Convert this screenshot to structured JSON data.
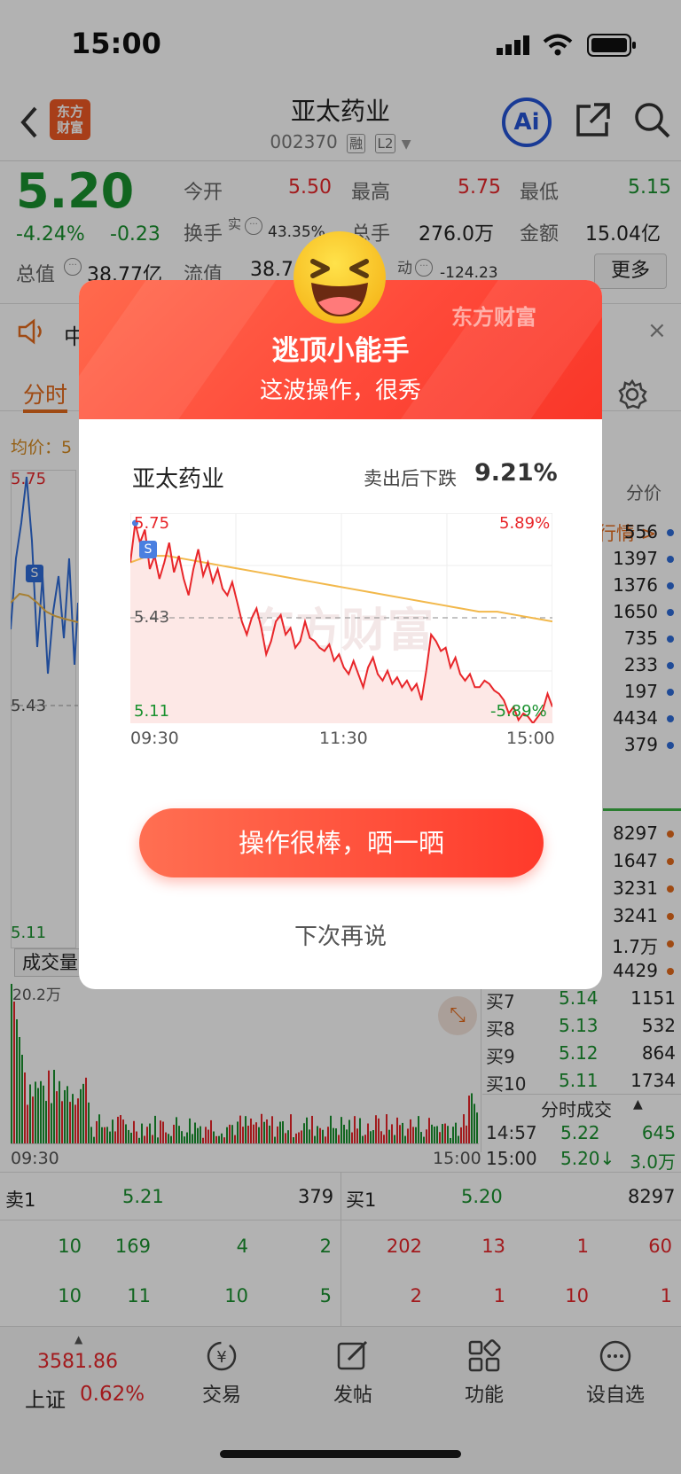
{
  "status": {
    "time": "15:00"
  },
  "header": {
    "logo": "东方\n财富",
    "logo_line1": "东方",
    "logo_line2": "财富",
    "title": "亚太药业",
    "code": "002370",
    "tag1": "融",
    "tag2": "L2",
    "ai": "Ai"
  },
  "quote": {
    "price": "5.20",
    "pct": "-4.24%",
    "chg": "-0.23",
    "open_label": "今开",
    "open": "5.50",
    "high_label": "最高",
    "high": "5.75",
    "low_label": "最低",
    "low": "5.15",
    "turnover_label": "换手",
    "turnover_sup": "实",
    "turnover": "43.35%",
    "vol_label": "总手",
    "vol": "276.0万",
    "amt_label": "金额",
    "amt": "15.04亿",
    "mcap_label": "总值",
    "mcap": "38.77亿",
    "float_label": "流值",
    "float": "38.7",
    "dyn_label": "动",
    "dyn": "-124.23",
    "more": "更多"
  },
  "notice": {
    "text": "中"
  },
  "tabs": {
    "first": "分时"
  },
  "left_chart": {
    "avg_label": "均价：5",
    "top": "5.75",
    "mid": "5.43",
    "bottom": "5.11",
    "vol_btn": "成交量",
    "vol_max": "20.2万",
    "t_start": "09:30",
    "t_end": "15:00"
  },
  "right_col": {
    "header": "分价",
    "link": "行情 >",
    "sell_vals": [
      "556",
      "1397",
      "1376",
      "1650",
      "735",
      "233",
      "197",
      "4434",
      "379"
    ],
    "buy_vals": [
      "8297",
      "1647",
      "3231",
      "3241",
      "1.7万",
      "4429"
    ],
    "buy_rows": [
      {
        "l": "买7",
        "p": "5.14",
        "v": "1151"
      },
      {
        "l": "买8",
        "p": "5.13",
        "v": "532"
      },
      {
        "l": "买9",
        "p": "5.12",
        "v": "864"
      },
      {
        "l": "买10",
        "p": "5.11",
        "v": "1734"
      }
    ],
    "tick_title": "分时成交",
    "ticks": [
      {
        "t": "14:57",
        "p": "5.22",
        "v": "645"
      },
      {
        "t": "15:00",
        "p": "5.20↓",
        "v": "3.0万"
      }
    ]
  },
  "level": {
    "sell1_label": "卖1",
    "sell1_price": "5.21",
    "sell1_vol": "379",
    "buy1_label": "买1",
    "buy1_price": "5.20",
    "buy1_vol": "8297",
    "row1_left": [
      "10",
      "169",
      "4",
      "2"
    ],
    "row1_right": [
      "202",
      "13",
      "1",
      "60"
    ],
    "row2_left": [
      "10",
      "11",
      "10",
      "5"
    ],
    "row2_right": [
      "2",
      "1",
      "10",
      "1"
    ]
  },
  "bottom_nav": {
    "index_value": "3581.86",
    "index_name": "上证",
    "index_pct": "0.62%",
    "items": [
      "交易",
      "发帖",
      "功能",
      "设自选"
    ]
  },
  "modal": {
    "brand": "东方财富",
    "title": "逃顶小能手",
    "subtitle": "这波操作，很秀",
    "stock": "亚太药业",
    "drop_label": "卖出后下跌",
    "drop_value": "9.21%",
    "y_top": "5.75",
    "y_mid": "5.43",
    "y_bottom": "5.11",
    "pct_top": "5.89%",
    "pct_bottom": "-5.89%",
    "x_labels": [
      "09:30",
      "11:30",
      "15:00"
    ],
    "sell_mark": "S",
    "watermark": "东方财富",
    "button": "操作很棒，晒一晒",
    "later": "下次再说"
  },
  "colors": {
    "red": "#e8262a",
    "green": "#19912e",
    "brand": "#ff4a3a"
  },
  "chart_data": {
    "type": "line",
    "x_start": "09:30",
    "x_mid": "11:30",
    "x_end": "15:00",
    "ylim": [
      5.11,
      5.75
    ],
    "ref": 5.43,
    "series": [
      {
        "name": "price",
        "values": [
          5.6,
          5.72,
          5.66,
          5.7,
          5.58,
          5.62,
          5.55,
          5.6,
          5.66,
          5.57,
          5.62,
          5.55,
          5.5,
          5.58,
          5.64,
          5.56,
          5.6,
          5.54,
          5.58,
          5.52,
          5.5,
          5.54,
          5.48,
          5.42,
          5.38,
          5.43,
          5.46,
          5.4,
          5.32,
          5.36,
          5.42,
          5.44,
          5.38,
          5.4,
          5.34,
          5.36,
          5.42,
          5.37,
          5.36,
          5.34,
          5.33,
          5.35,
          5.3,
          5.32,
          5.28,
          5.26,
          5.3,
          5.26,
          5.22,
          5.28,
          5.31,
          5.26,
          5.24,
          5.27,
          5.23,
          5.25,
          5.22,
          5.24,
          5.21,
          5.23,
          5.18,
          5.27,
          5.38,
          5.36,
          5.33,
          5.34,
          5.28,
          5.31,
          5.26,
          5.24,
          5.26,
          5.22,
          5.22,
          5.24,
          5.23,
          5.21,
          5.2,
          5.18,
          5.14,
          5.16,
          5.12,
          5.14,
          5.13,
          5.11,
          5.13,
          5.15,
          5.2,
          5.16
        ]
      },
      {
        "name": "avg",
        "values": [
          5.6,
          5.62,
          5.62,
          5.61,
          5.6,
          5.59,
          5.58,
          5.57,
          5.56,
          5.55,
          5.54,
          5.53,
          5.52,
          5.51,
          5.5,
          5.49,
          5.48,
          5.47,
          5.46,
          5.45,
          5.45,
          5.44,
          5.43,
          5.42
        ]
      }
    ]
  }
}
